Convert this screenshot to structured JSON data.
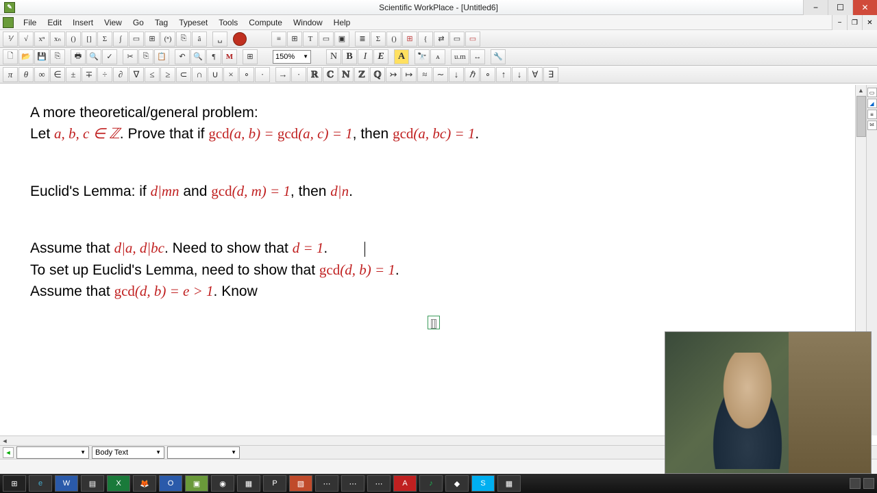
{
  "window": {
    "title": "Scientific WorkPlace - [Untitled6]"
  },
  "menu": {
    "items": [
      "File",
      "Edit",
      "Insert",
      "View",
      "Go",
      "Tag",
      "Typeset",
      "Tools",
      "Compute",
      "Window",
      "Help"
    ]
  },
  "toolbar3": {
    "zoom": "150%",
    "normal": "N",
    "bold": "B",
    "italic": "I",
    "emph": "E",
    "highlight": "A"
  },
  "mathsymbols": {
    "row": [
      "π",
      "θ",
      "∞",
      "∈",
      "±",
      "∓",
      "÷",
      "∂",
      "∇",
      "≤",
      "≥",
      "⊂",
      "∩",
      "∪",
      "×",
      "∘",
      "·"
    ],
    "row2": [
      "→",
      "·",
      "ℝ",
      "ℂ",
      "ℕ",
      "ℤ",
      "ℚ",
      "↣",
      "↦",
      "≈",
      "∼",
      "↓",
      "ℏ",
      "∘",
      "↑",
      "↓",
      "∀",
      "∃"
    ]
  },
  "bottom": {
    "style_label": "Body Text"
  },
  "doc": {
    "p1a": "A more theoretical/general problem:",
    "p1b_pre": "Let ",
    "p1b_m1": "a, b, c ∈ ℤ",
    "p1b_mid": ". Prove that if ",
    "p1b_gcd": "gcd",
    "p1b_m2": "(a, b) = ",
    "p1b_gcd2": "gcd",
    "p1b_m3": "(a, c) = 1",
    "p1b_mid2": ", then ",
    "p1b_gcd3": "gcd",
    "p1b_m4": "(a, bc) = 1",
    "p1b_end": ".",
    "p2_pre": "Euclid's Lemma: if ",
    "p2_m1": "d|mn",
    "p2_mid": " and ",
    "p2_gcd": "gcd",
    "p2_m2": "(d, m) = 1",
    "p2_mid2": ", then ",
    "p2_m3": "d|n",
    "p2_end": ".",
    "p3_pre": "Assume that ",
    "p3_m1": "d|a,  d|bc",
    "p3_mid": ". Need to show that ",
    "p3_m2": "d = 1",
    "p3_end": ".",
    "p4_pre": "To set up Euclid's Lemma, need to show that ",
    "p4_gcd": "gcd",
    "p4_m1": "(d, b) = 1",
    "p4_end": ".",
    "p5_pre": "Assume that ",
    "p5_gcd": "gcd",
    "p5_m1": "(d, b) = e > 1",
    "p5_mid": ". Know"
  },
  "taskbar": {
    "items": [
      "⊞",
      "e",
      "W",
      "▤",
      "X",
      "🦊",
      "O",
      "▣",
      "◉",
      "▦",
      "P",
      "▧",
      "⋯",
      "⋯",
      "⋯",
      "A",
      "♪",
      "◆",
      "S",
      "▦"
    ]
  }
}
